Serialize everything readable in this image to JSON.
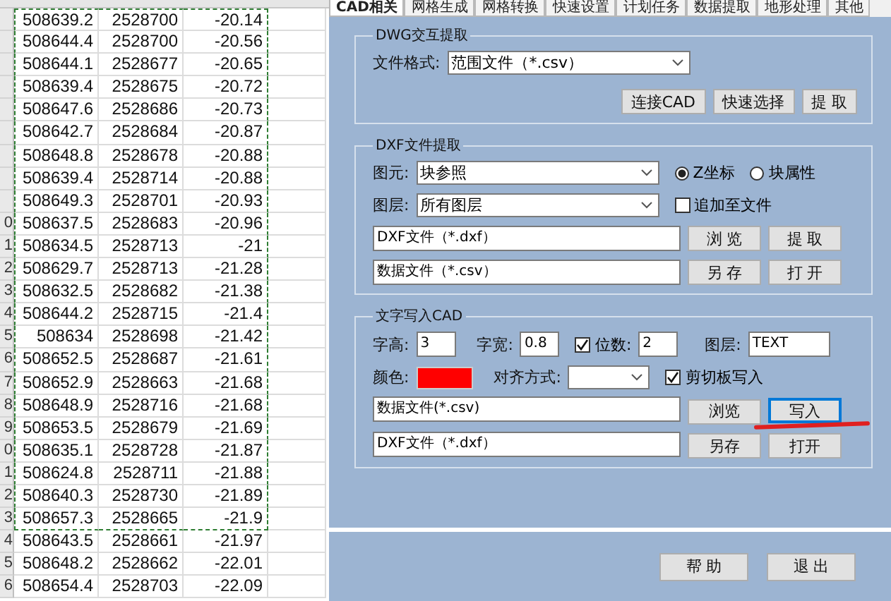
{
  "sheet": {
    "rows": [
      {
        "header": "",
        "cells": [
          "508639.2",
          "2528700",
          "-20.14"
        ],
        "in_selection": true
      },
      {
        "header": "",
        "cells": [
          "508644.4",
          "2528700",
          "-20.56"
        ],
        "in_selection": true
      },
      {
        "header": "",
        "cells": [
          "508644.1",
          "2528677",
          "-20.65"
        ],
        "in_selection": true
      },
      {
        "header": "",
        "cells": [
          "508639.4",
          "2528675",
          "-20.72"
        ],
        "in_selection": true
      },
      {
        "header": "",
        "cells": [
          "508647.6",
          "2528686",
          "-20.73"
        ],
        "in_selection": true
      },
      {
        "header": "",
        "cells": [
          "508642.7",
          "2528684",
          "-20.87"
        ],
        "in_selection": true
      },
      {
        "header": "",
        "cells": [
          "508648.8",
          "2528678",
          "-20.88"
        ],
        "in_selection": true
      },
      {
        "header": "",
        "cells": [
          "508639.4",
          "2528714",
          "-20.88"
        ],
        "in_selection": true
      },
      {
        "header": "",
        "cells": [
          "508649.3",
          "2528701",
          "-20.93"
        ],
        "in_selection": true
      },
      {
        "header": "0",
        "cells": [
          "508637.5",
          "2528683",
          "-20.96"
        ],
        "in_selection": true
      },
      {
        "header": "1",
        "cells": [
          "508634.5",
          "2528713",
          "-21"
        ],
        "in_selection": true
      },
      {
        "header": "2",
        "cells": [
          "508629.7",
          "2528713",
          "-21.28"
        ],
        "in_selection": true
      },
      {
        "header": "3",
        "cells": [
          "508632.5",
          "2528682",
          "-21.38"
        ],
        "in_selection": true
      },
      {
        "header": "4",
        "cells": [
          "508644.2",
          "2528715",
          "-21.4"
        ],
        "in_selection": true
      },
      {
        "header": "5",
        "cells": [
          "508634",
          "2528698",
          "-21.42"
        ],
        "in_selection": true
      },
      {
        "header": "6",
        "cells": [
          "508652.5",
          "2528687",
          "-21.61"
        ],
        "in_selection": true
      },
      {
        "header": "7",
        "cells": [
          "508652.9",
          "2528663",
          "-21.68"
        ],
        "in_selection": true
      },
      {
        "header": "8",
        "cells": [
          "508648.9",
          "2528716",
          "-21.68"
        ],
        "in_selection": true
      },
      {
        "header": "9",
        "cells": [
          "508653.5",
          "2528679",
          "-21.69"
        ],
        "in_selection": true
      },
      {
        "header": "0",
        "cells": [
          "508635.1",
          "2528728",
          "-21.87"
        ],
        "in_selection": true
      },
      {
        "header": "1",
        "cells": [
          "508624.8",
          "2528711",
          "-21.88"
        ],
        "in_selection": true
      },
      {
        "header": "2",
        "cells": [
          "508640.3",
          "2528730",
          "-21.89"
        ],
        "in_selection": true
      },
      {
        "header": "3",
        "cells": [
          "508657.3",
          "2528665",
          "-21.9"
        ],
        "in_selection": true
      },
      {
        "header": "4",
        "cells": [
          "508643.5",
          "2528661",
          "-21.97"
        ],
        "in_selection": false
      },
      {
        "header": "5",
        "cells": [
          "508648.2",
          "2528662",
          "-22.01"
        ],
        "in_selection": false
      },
      {
        "header": "6",
        "cells": [
          "508654.4",
          "2528703",
          "-22.09"
        ],
        "in_selection": false
      }
    ]
  },
  "tabs": [
    {
      "label": "CAD相关",
      "selected": true
    },
    {
      "label": "网格生成",
      "selected": false
    },
    {
      "label": "网格转换",
      "selected": false
    },
    {
      "label": "快速设置",
      "selected": false
    },
    {
      "label": "计划任务",
      "selected": false
    },
    {
      "label": "数据提取",
      "selected": false
    },
    {
      "label": "地形处理",
      "selected": false
    },
    {
      "label": "其他",
      "selected": false
    }
  ],
  "dwg_group": {
    "title": "DWG交互提取",
    "format_label": "文件格式:",
    "format_value": "范围文件（*.csv）",
    "buttons": [
      "连接CAD",
      "快速选择",
      "提 取"
    ]
  },
  "dxf_group": {
    "title": "DXF文件提取",
    "element_label": "图元:",
    "element_value": "块参照",
    "radios": [
      {
        "label": "Z坐标",
        "selected": true
      },
      {
        "label": "块属性",
        "selected": false
      }
    ],
    "layer_label": "图层:",
    "layer_value": "所有图层",
    "append": {
      "label": "追加至文件",
      "checked": false
    },
    "file_rows": [
      {
        "value": "DXF文件（*.dxf）",
        "buttons": [
          "浏 览",
          "提 取"
        ]
      },
      {
        "value": "数据文件（*.csv）",
        "buttons": [
          "另 存",
          "打 开"
        ]
      }
    ]
  },
  "text_group": {
    "title": "文字写入CAD",
    "height_label": "字高:",
    "height_value": "3",
    "width_label": "字宽:",
    "width_value": "0.8",
    "digits": {
      "label": "位数:",
      "checked": true,
      "value": "2"
    },
    "layer_label": "图层:",
    "layer_value": "TEXT",
    "color_label": "颜色:",
    "color": "#ff0000",
    "align_label": "对齐方式:",
    "clipboard": {
      "label": "剪切板写入",
      "checked": true
    },
    "file_rows": [
      {
        "value": "数据文件(*.csv)",
        "buttons": [
          {
            "label": "浏览",
            "focused": false
          },
          {
            "label": "写入",
            "focused": true
          }
        ]
      },
      {
        "value": "DXF文件（*.dxf）",
        "buttons": [
          {
            "label": "另存",
            "focused": false
          },
          {
            "label": "打开",
            "focused": false
          }
        ]
      }
    ]
  },
  "footer_buttons": [
    "帮 助",
    "退 出"
  ]
}
